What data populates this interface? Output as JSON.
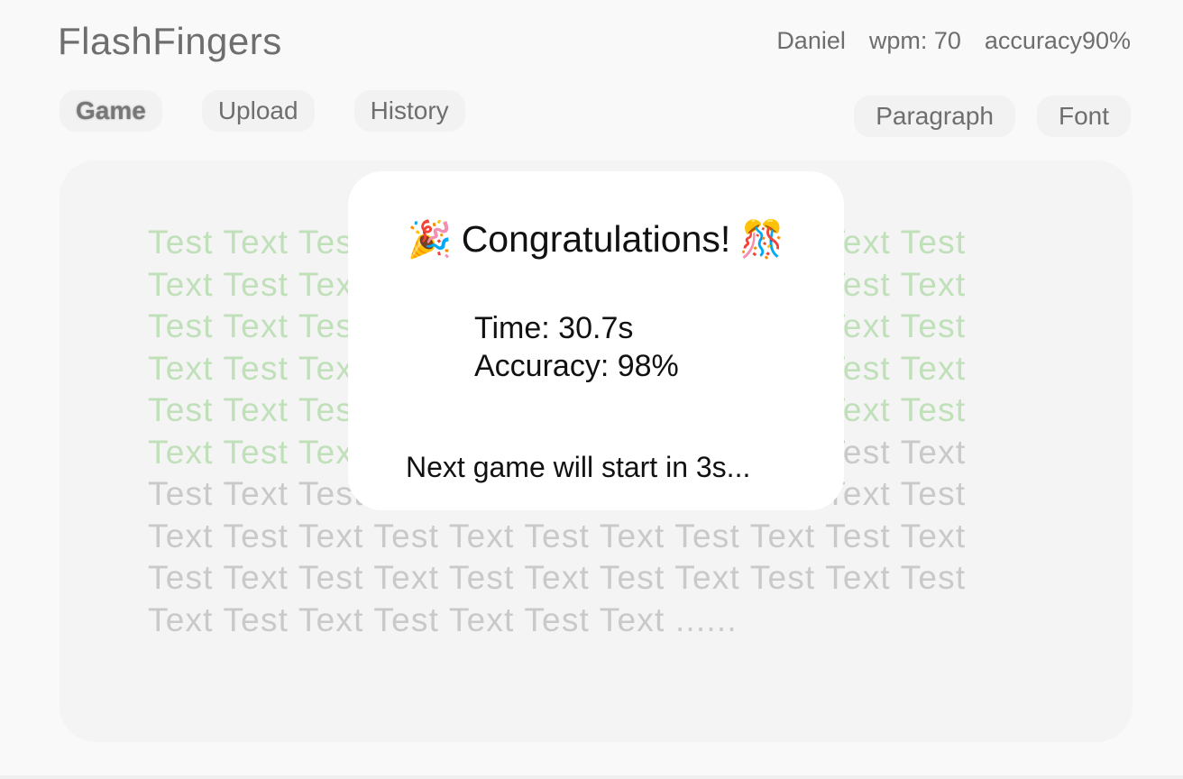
{
  "app": {
    "title": "FlashFingers"
  },
  "user": {
    "name": "Daniel",
    "wpm": "wpm: 70",
    "accuracy": "accuracy90%"
  },
  "nav": {
    "game": "Game",
    "upload": "Upload",
    "history": "History"
  },
  "options": {
    "paragraph": "Paragraph",
    "font": "Font"
  },
  "passage": {
    "typed_lines": [
      "Test Text Test Text Test Text Test Text Test Text Test",
      "Text Test Text Test Text Test Text Test Text Test Text",
      "Test Text Test Text Test Text Test Text Test Text Test",
      "Text Test Text Test Text Test Text Test Text Test Text",
      "Test Text Test Text Test Text Test Text Test Text Test"
    ],
    "partial_line_typed": "Text Test Text",
    "partial_line_rest": " Test Text Test Text Test Text Test Text",
    "remaining_lines": [
      "Test Text Test Text Test Text Test Text Test Text Test",
      "Text Test Text Test Text Test Text Test Text Test Text",
      "Test Text Test Text Test Text Test Text Test Text Test",
      "Text Test Text Test Text Test Text ......"
    ]
  },
  "modal": {
    "title": "Congratulations!",
    "left_emoji": "🎉",
    "right_emoji": "🎊",
    "left_emoji_icon": "party-popper-icon",
    "right_emoji_icon": "confetti-ball-icon",
    "time": "Time: 30.7s",
    "accuracy": "Accuracy: 98%",
    "countdown": "Next game will start in 3s..."
  },
  "colors": {
    "background": "#f9f9f9",
    "panel": "#f4f4f4",
    "typed_text": "#bfe0b9",
    "untyped_text": "#c9c9c9",
    "modal": "#ffffff"
  }
}
